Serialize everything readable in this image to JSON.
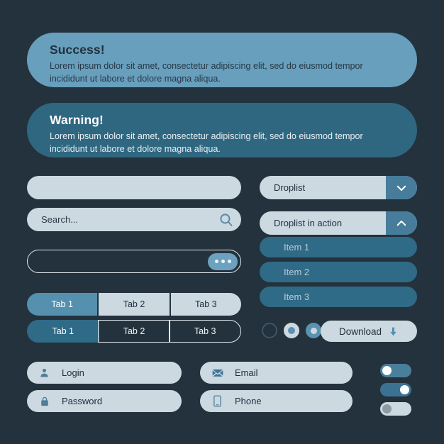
{
  "theme": {
    "background": "#24323d",
    "light_surface": "#ccd9e1",
    "accent_blue": "#4a7f9c",
    "accent_light": "#679fbd",
    "accent_dark": "#2f6780",
    "text_dark": "#22303c",
    "text_light": "#ffffff"
  },
  "alerts": [
    {
      "id": "success",
      "title": "Success!",
      "body": "Lorem ipsum dolor sit amet, consectetur adipiscing elit, sed do eiusmod tempor incididunt ut labore et dolore magna aliqua.",
      "color": "#679fbd"
    },
    {
      "id": "warning",
      "title": "Warning!",
      "body": "Lorem ipsum dolor sit amet, consectetur adipiscing elit, sed do eiusmod tempor incididunt ut labore et dolore magna aliqua.",
      "color": "#2f6780"
    }
  ],
  "inputs": {
    "plain": {
      "value": "",
      "placeholder": ""
    },
    "search": {
      "value": "",
      "placeholder": "Search...",
      "icon": "search-icon"
    },
    "outlined": {
      "value": "",
      "placeholder": "",
      "action_icon": "more-horizontal-icon"
    }
  },
  "droplists": [
    {
      "id": "collapsed",
      "label": "Droplist",
      "state": "collapsed",
      "icon": "chevron-down-icon",
      "items": []
    },
    {
      "id": "expanded",
      "label": "Droplist in action",
      "state": "expanded",
      "icon": "chevron-up-icon",
      "items": [
        "Item 1",
        "Item 2",
        "Item 3"
      ]
    }
  ],
  "tab_groups": [
    {
      "id": "filled",
      "style": "filled",
      "active_index": 0,
      "tabs": [
        "Tab 1",
        "Tab 2",
        "Tab 3"
      ]
    },
    {
      "id": "outlined",
      "style": "outlined",
      "active_index": 0,
      "tabs": [
        "Tab 1",
        "Tab 2",
        "Tab 3"
      ]
    }
  ],
  "radios": [
    {
      "id": "radio-1",
      "state": "empty",
      "checked": false
    },
    {
      "id": "radio-2",
      "state": "ring",
      "checked": true
    },
    {
      "id": "radio-3",
      "state": "solid",
      "checked": true
    }
  ],
  "download": {
    "label": "Download",
    "icon": "arrow-down-icon"
  },
  "buttons": [
    {
      "id": "login",
      "label": "Login",
      "icon": "user-icon"
    },
    {
      "id": "password",
      "label": "Password",
      "icon": "lock-icon"
    },
    {
      "id": "email",
      "label": "Email",
      "icon": "envelope-icon"
    },
    {
      "id": "phone",
      "label": "Phone",
      "icon": "mobile-icon"
    }
  ],
  "toggles": [
    {
      "id": "toggle-1",
      "state": "on",
      "knob": "left",
      "track": "#4a7f9c"
    },
    {
      "id": "toggle-2",
      "state": "on",
      "knob": "right",
      "track": "#3c7291"
    },
    {
      "id": "toggle-3",
      "state": "disabled",
      "knob": "left",
      "track": "#ccd9e1"
    }
  ]
}
